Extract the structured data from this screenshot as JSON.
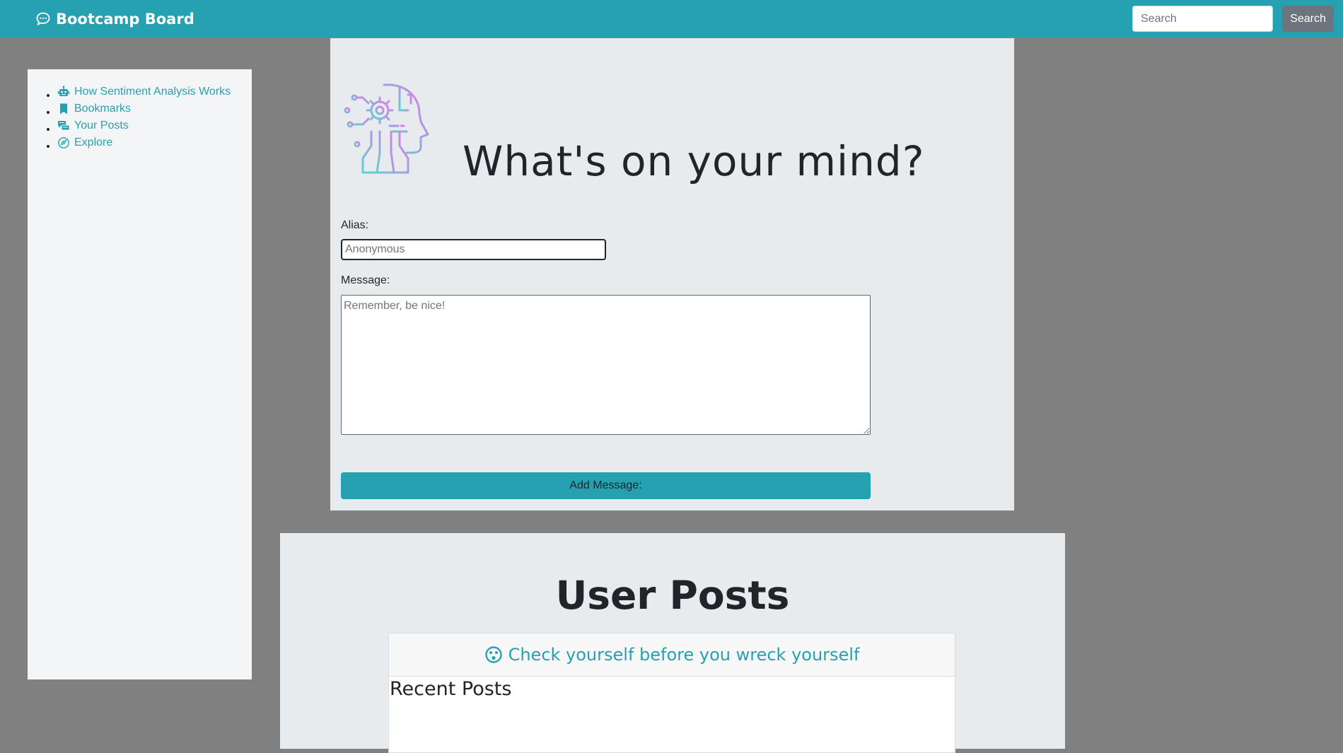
{
  "navbar": {
    "brand": "Bootcamp Board",
    "brand_icon": "chat-bubble-icon",
    "search_placeholder": "Search",
    "search_button": "Search",
    "accent_color": "#26a1b1"
  },
  "sidebar": {
    "items": [
      {
        "label": "How Sentiment Analysis Works",
        "icon": "robot-icon"
      },
      {
        "label": "Bookmarks",
        "icon": "bookmark-icon"
      },
      {
        "label": "Your Posts",
        "icon": "posts-icon"
      },
      {
        "label": "Explore",
        "icon": "compass-icon"
      }
    ]
  },
  "form": {
    "title": "What's on your mind?",
    "logo_icon": "ai-head-icon",
    "alias_label": "Alias:",
    "alias_placeholder": "Anonymous",
    "message_label": "Message:",
    "message_placeholder": "Remember, be nice!",
    "submit_label": "Add Message:"
  },
  "posts": {
    "title": "User Posts",
    "banner": "Check yourself before you wreck yourself",
    "banner_icon": "surprised-face-icon",
    "recent_title": "Recent Posts"
  }
}
